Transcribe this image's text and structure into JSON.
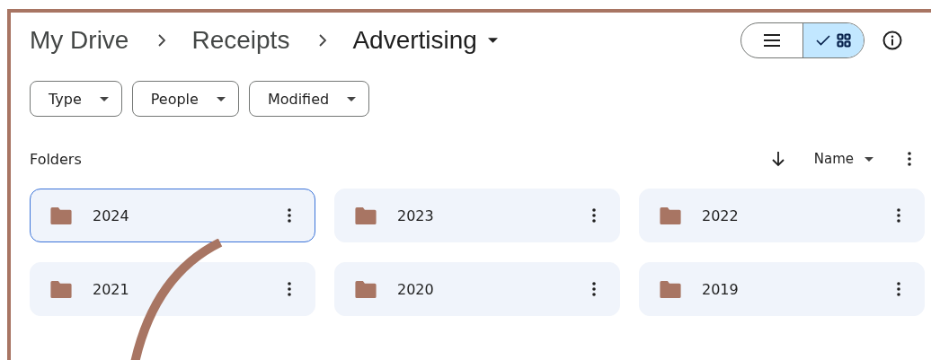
{
  "breadcrumb": [
    {
      "label": "My Drive",
      "current": false
    },
    {
      "label": "Receipts",
      "current": false
    },
    {
      "label": "Advertising",
      "current": true
    }
  ],
  "view_toggle": [
    {
      "kind": "list",
      "selected": false
    },
    {
      "kind": "grid",
      "selected": true
    }
  ],
  "filters": [
    {
      "label": "Type"
    },
    {
      "label": "People"
    },
    {
      "label": "Modified"
    }
  ],
  "section": {
    "title": "Folders",
    "sort": {
      "label": "Name"
    }
  },
  "folders": [
    {
      "name": "2024",
      "selected": true
    },
    {
      "name": "2023",
      "selected": false
    },
    {
      "name": "2022",
      "selected": false
    },
    {
      "name": "2021",
      "selected": false
    },
    {
      "name": "2020",
      "selected": false
    },
    {
      "name": "2019",
      "selected": false
    }
  ]
}
